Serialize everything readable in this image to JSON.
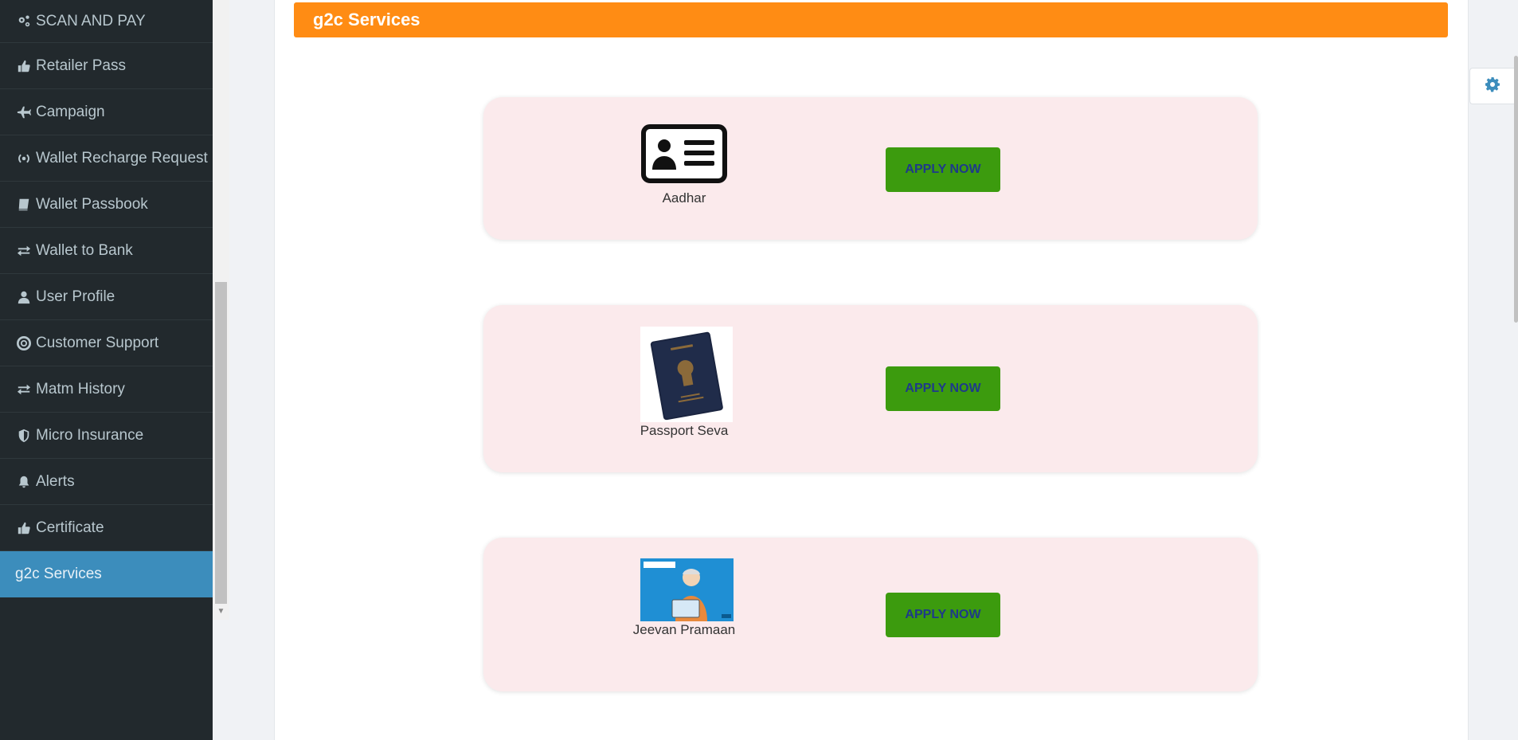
{
  "sidebar": {
    "items": [
      {
        "label": "SCAN AND PAY",
        "icon": "gears-icon"
      },
      {
        "label": "Retailer Pass",
        "icon": "thumbs-up-icon"
      },
      {
        "label": "Campaign",
        "icon": "plane-icon"
      },
      {
        "label": "Wallet Recharge Request",
        "icon": "signal-icon"
      },
      {
        "label": "Wallet Passbook",
        "icon": "book-icon"
      },
      {
        "label": "Wallet to Bank",
        "icon": "exchange-icon"
      },
      {
        "label": "User Profile",
        "icon": "user-icon"
      },
      {
        "label": "Customer Support",
        "icon": "lifebuoy-icon"
      },
      {
        "label": "Matm History",
        "icon": "exchange-icon"
      },
      {
        "label": "Micro Insurance",
        "icon": "shield-icon"
      },
      {
        "label": "Alerts",
        "icon": "bell-icon"
      },
      {
        "label": "Certificate",
        "icon": "thumbs-up-icon"
      },
      {
        "label": "g2c Services",
        "icon": "none"
      }
    ],
    "active_color": "#3c8dbc"
  },
  "header": {
    "title": "g2c Services",
    "color": "#ff8c14"
  },
  "services": [
    {
      "name": "Aadhar",
      "button": "APPLY NOW",
      "icon": "id-card-icon"
    },
    {
      "name": "Passport Seva",
      "button": "APPLY NOW",
      "icon": "passport-image"
    },
    {
      "name": "Jeevan Pramaan",
      "button": "APPLY NOW",
      "icon": "jeevan-pramaan-image"
    }
  ],
  "settings_icon": "gear-icon"
}
